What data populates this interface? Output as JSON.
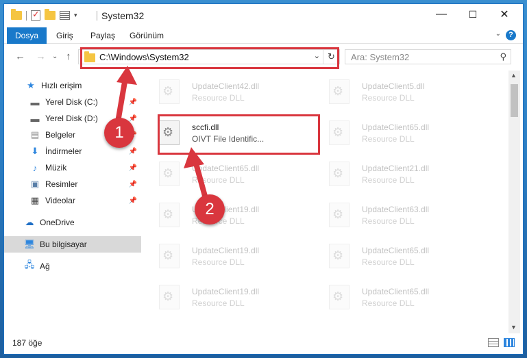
{
  "window": {
    "title": "System32",
    "controls": {
      "minimize": "—",
      "maximize": "☐",
      "close": "✕"
    }
  },
  "ribbon": {
    "tabs": [
      "Dosya",
      "Giriş",
      "Paylaş",
      "Görünüm"
    ],
    "help": "?"
  },
  "address": {
    "path": "C:\\Windows\\System32",
    "search_placeholder": "Ara: System32"
  },
  "sidebar": {
    "items": [
      {
        "label": "Hızlı erişim",
        "icon": "star-icon"
      },
      {
        "label": "Yerel Disk (C:)",
        "icon": "drive-icon"
      },
      {
        "label": "Yerel Disk (D:)",
        "icon": "drive-icon"
      },
      {
        "label": "Belgeler",
        "icon": "documents-icon"
      },
      {
        "label": "İndirmeler",
        "icon": "download-icon"
      },
      {
        "label": "Müzik",
        "icon": "music-icon"
      },
      {
        "label": "Resimler",
        "icon": "pictures-icon"
      },
      {
        "label": "Videolar",
        "icon": "video-icon"
      },
      {
        "label": "OneDrive",
        "icon": "cloud-icon"
      },
      {
        "label": "Bu bilgisayar",
        "icon": "computer-icon"
      },
      {
        "label": "Ağ",
        "icon": "network-icon"
      }
    ]
  },
  "files": {
    "left": [
      {
        "name": "UpdateClient42.dll",
        "type": "Resource DLL"
      },
      {
        "name": "sccfi.dll",
        "type": "OIVT File Identific..."
      },
      {
        "name": "UpdateClient65.dll",
        "type": "Resource DLL"
      },
      {
        "name": "UpdateClient19.dll",
        "type": "Resource DLL"
      },
      {
        "name": "UpdateClient19.dll",
        "type": "Resource DLL"
      },
      {
        "name": "UpdateClient19.dll",
        "type": "Resource DLL"
      }
    ],
    "right": [
      {
        "name": "UpdateClient5.dll",
        "type": "Resource DLL"
      },
      {
        "name": "UpdateClient65.dll",
        "type": "Resource DLL"
      },
      {
        "name": "UpdateClient21.dll",
        "type": "Resource DLL"
      },
      {
        "name": "UpdateClient63.dll",
        "type": "Resource DLL"
      },
      {
        "name": "UpdateClient65.dll",
        "type": "Resource DLL"
      },
      {
        "name": "UpdateClient65.dll",
        "type": "Resource DLL"
      }
    ]
  },
  "status": {
    "count": "187 öğe"
  },
  "annotations": {
    "badge1": "1",
    "badge2": "2",
    "accent": "#d9363e"
  }
}
